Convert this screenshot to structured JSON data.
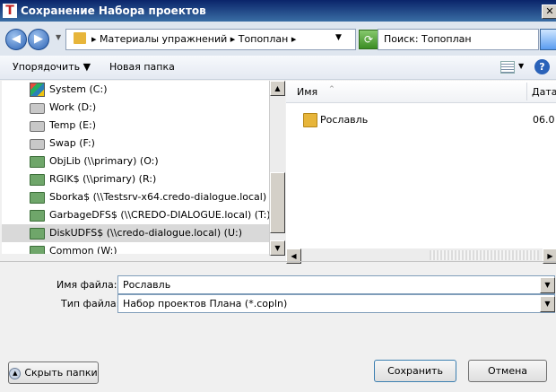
{
  "window": {
    "title": "Сохранение Набора проектов",
    "app_icon": "Т"
  },
  "address": {
    "path": [
      "Материалы упражнений",
      "Топоплан"
    ],
    "path_text": "▸ Материалы упражнений ▸ Топоплан ▸",
    "search_placeholder": "Поиск: Топоплан"
  },
  "toolbar": {
    "organize_label": "Упорядочить ▼",
    "new_folder_label": "Новая папка"
  },
  "tree": {
    "items": [
      {
        "label": "System (C:)",
        "icon": "system-drive-icon"
      },
      {
        "label": "Work (D:)",
        "icon": "drive-icon"
      },
      {
        "label": "Temp (E:)",
        "icon": "drive-icon"
      },
      {
        "label": "Swap (F:)",
        "icon": "drive-icon"
      },
      {
        "label": "ObjLib (\\\\primary) (O:)",
        "icon": "network-drive-icon"
      },
      {
        "label": "RGIK$ (\\\\primary) (R:)",
        "icon": "network-drive-icon"
      },
      {
        "label": "Sborka$ (\\\\Testsrv-x64.credo-dialogue.local) (S:)",
        "icon": "network-drive-icon"
      },
      {
        "label": "GarbageDFS$ (\\\\CREDO-DIALOGUE.local) (T:)",
        "icon": "network-drive-icon"
      },
      {
        "label": "DiskUDFS$ (\\\\credo-dialogue.local) (U:)",
        "icon": "network-drive-icon",
        "selected": true
      },
      {
        "label": "Common (W:)",
        "icon": "network-drive-icon"
      }
    ]
  },
  "files": {
    "columns": [
      "Имя",
      "Дата"
    ],
    "rows": [
      {
        "name": "Рославль",
        "date": "06.0"
      }
    ]
  },
  "form": {
    "filename_label": "Имя файла:",
    "filename_value": "Рославль",
    "filetype_label": "Тип файла:",
    "filetype_value": "Набор проектов Плана (*.copln)"
  },
  "buttons": {
    "hide_folders": "Скрыть папки",
    "save": "Сохранить",
    "cancel": "Отмена"
  },
  "colors": {
    "title_bar": "#0a246a",
    "selection": "#d9d9d9",
    "folder": "#e7b53a"
  }
}
